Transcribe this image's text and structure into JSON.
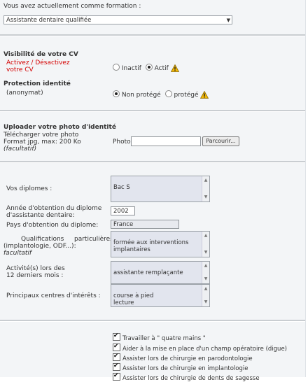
{
  "formation": {
    "label": "Vous avez actuellement comme formation :",
    "selected": "Assistante dentaire qualifiée"
  },
  "visibilite": {
    "title": "Visibilité de votre CV",
    "hint": "Activez / Désactivez\nvotre CV",
    "option_inactive": "Inactif",
    "option_active": "Actif",
    "selected": "Actif"
  },
  "protection": {
    "title": "Protection identité",
    "hint": "(anonymat)",
    "option_non_protege": "Non protégé",
    "option_protege": "protégé",
    "selected": "Non protégé"
  },
  "photo": {
    "title": "Uploader votre photo d'identité",
    "line1": "Télécharger votre photo",
    "line2": "Format jpg, max: 200 Ko",
    "line3": "(facultatif)",
    "field_label": "Photo :",
    "browse_label": "Parcourir..."
  },
  "diplomes": {
    "label": "Vos diplomes :",
    "value": "Bac S"
  },
  "annee": {
    "label": "Année d'obtention du diplome\nd'assistante dentaire:",
    "value": "2002"
  },
  "pays": {
    "label": "Pays d'obtention du diplome:",
    "value": "France"
  },
  "qualifications": {
    "label_a": "Qualifications",
    "label_b": "particulières",
    "label_c": "(implantologie, ODF...):",
    "label_d": "facultatif",
    "value": "formée aux interventions\nimplantaires"
  },
  "activite": {
    "label": "Activité(s) lors des\n12 derniers mois :",
    "value": "assistante remplaçante"
  },
  "interets": {
    "label": "Principaux centres d'intérêts :",
    "value": "course à pied\nlecture"
  },
  "competences": [
    {
      "label": "Travailler à \" quatre mains \"",
      "checked": true
    },
    {
      "label": "Aider à la mise en place d'un champ opératoire (digue)",
      "checked": true
    },
    {
      "label": "Assister lors de chirurgie en parodontologie",
      "checked": true
    },
    {
      "label": "Assister lors de chirurgie en implantologie",
      "checked": true
    },
    {
      "label": "Assister lors de chirurgie de dents de sagesse",
      "checked": true
    }
  ]
}
